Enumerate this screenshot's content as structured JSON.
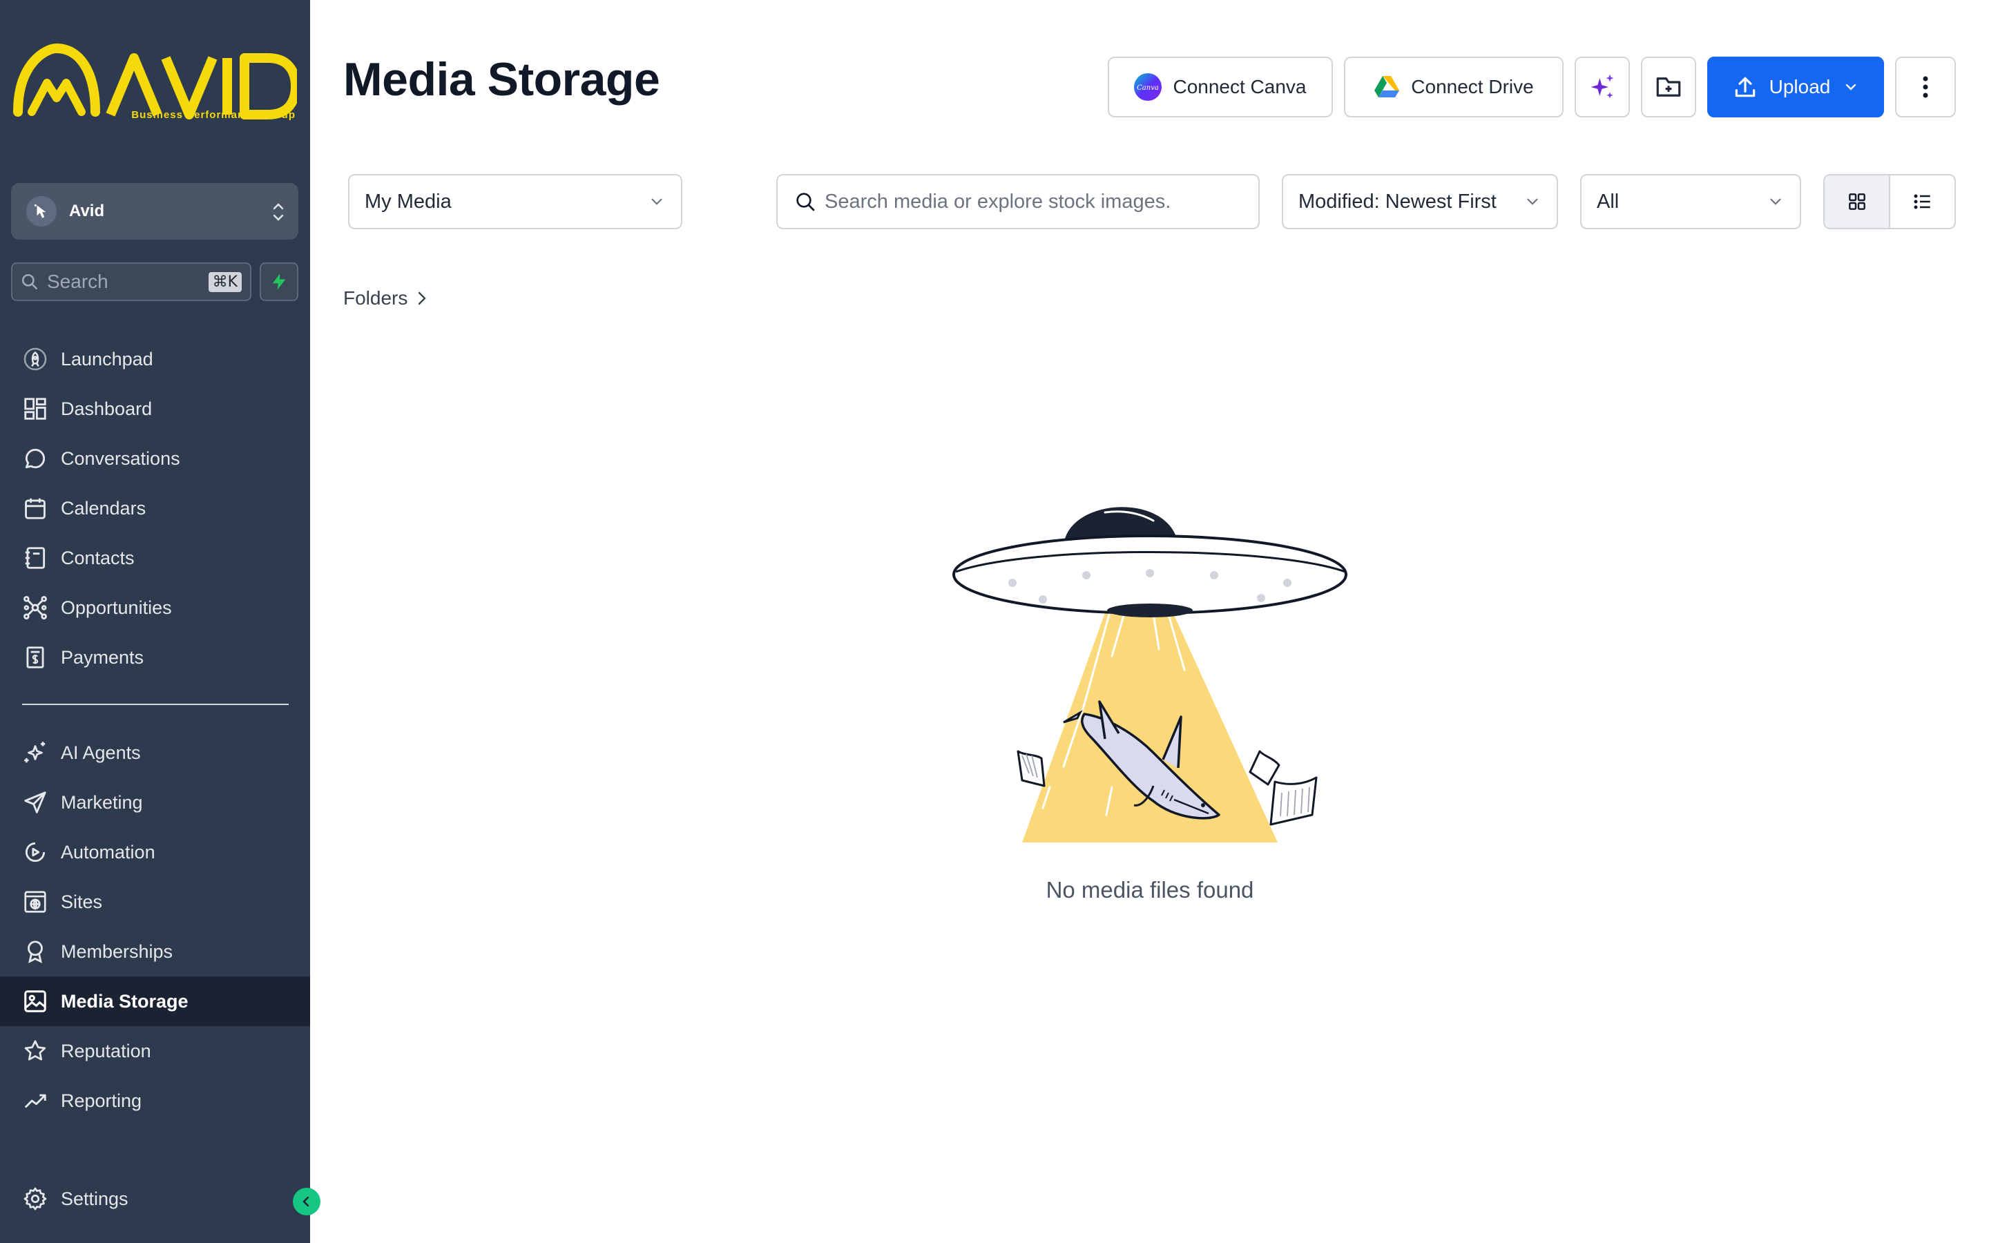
{
  "brand": {
    "logo_word": "AVID",
    "logo_tagline": "Business Performance Group",
    "accent": "#f5d90a"
  },
  "sidebar": {
    "account_name": "Avid",
    "search_placeholder": "Search",
    "search_shortcut": "⌘K",
    "items": [
      {
        "label": "Launchpad",
        "icon": "rocket-icon"
      },
      {
        "label": "Dashboard",
        "icon": "grid-icon"
      },
      {
        "label": "Conversations",
        "icon": "chat-bubble-icon"
      },
      {
        "label": "Calendars",
        "icon": "calendar-icon"
      },
      {
        "label": "Contacts",
        "icon": "contact-book-icon"
      },
      {
        "label": "Opportunities",
        "icon": "network-icon"
      },
      {
        "label": "Payments",
        "icon": "invoice-dollar-icon"
      }
    ],
    "items2": [
      {
        "label": "AI Agents",
        "icon": "sparkle-icon"
      },
      {
        "label": "Marketing",
        "icon": "paper-plane-icon"
      },
      {
        "label": "Automation",
        "icon": "play-circle-icon"
      },
      {
        "label": "Sites",
        "icon": "globe-window-icon"
      },
      {
        "label": "Memberships",
        "icon": "award-icon"
      },
      {
        "label": "Media Storage",
        "icon": "image-icon",
        "active": true
      },
      {
        "label": "Reputation",
        "icon": "star-icon"
      },
      {
        "label": "Reporting",
        "icon": "trend-line-icon"
      }
    ],
    "settings_label": "Settings",
    "bg_color": "#2e3a4e"
  },
  "header": {
    "title": "Media Storage",
    "connect_canva": "Connect Canva",
    "canva_badge": "Canva",
    "connect_drive": "Connect Drive",
    "upload_label": "Upload",
    "primary_color": "#1566f0"
  },
  "filters": {
    "library_select": "My Media",
    "search_placeholder": "Search media or explore stock images.",
    "sort_select": "Modified: Newest First",
    "type_select": "All"
  },
  "breadcrumb": {
    "folders_label": "Folders"
  },
  "empty_state": {
    "message": "No media files found"
  }
}
